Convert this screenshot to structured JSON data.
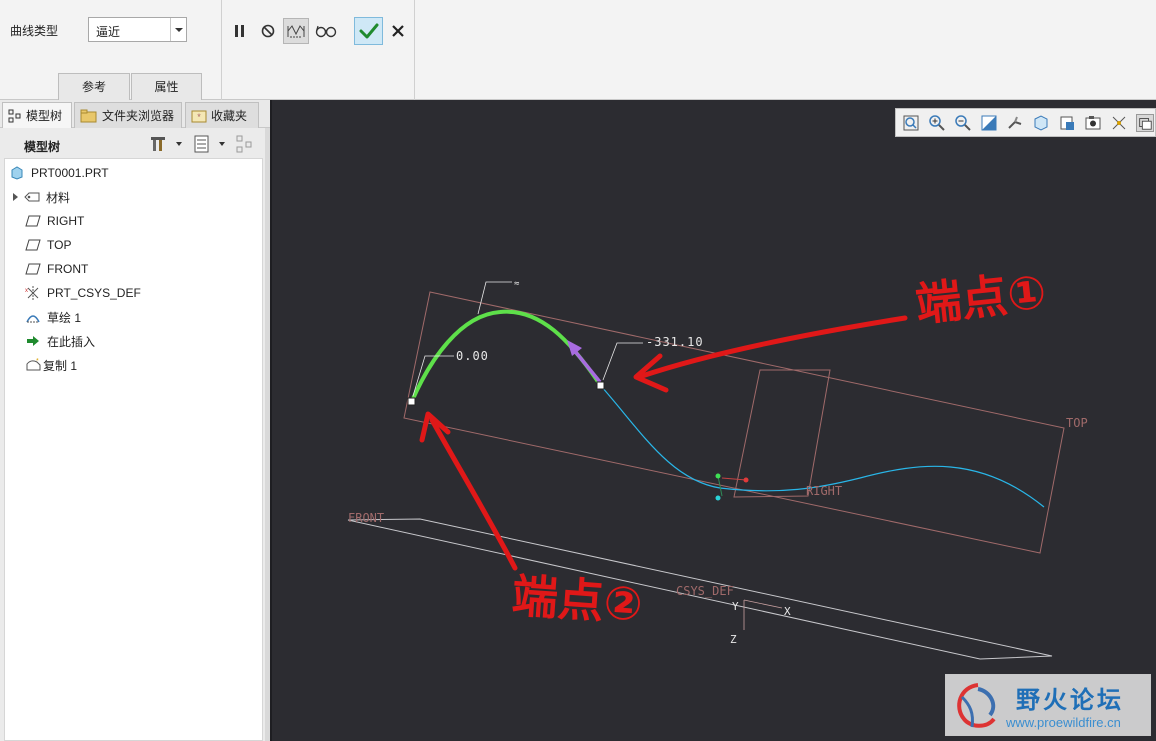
{
  "dashboard": {
    "curve_type_label": "曲线类型",
    "curve_type_value": "逼近",
    "tab_reference": "参考",
    "tab_properties": "属性",
    "tools": [
      "pause-icon",
      "stop-icon",
      "preview-icon",
      "glasses-icon",
      "check-icon",
      "close-icon"
    ]
  },
  "left_panel": {
    "tabs": [
      "模型树",
      "文件夹浏览器",
      "收藏夹"
    ],
    "header_title": "模型树",
    "tree": [
      {
        "label": "PRT0001.PRT",
        "icon": "part-icon"
      },
      {
        "label": "材料",
        "icon": "material-icon"
      },
      {
        "label": "RIGHT",
        "icon": "datum-plane-icon"
      },
      {
        "label": "TOP",
        "icon": "datum-plane-icon"
      },
      {
        "label": "FRONT",
        "icon": "datum-plane-icon"
      },
      {
        "label": "PRT_CSYS_DEF",
        "icon": "csys-icon"
      },
      {
        "label": "草绘 1",
        "icon": "sketch-icon"
      },
      {
        "label": "在此插入",
        "icon": "insert-arrow-icon"
      },
      {
        "label": "复制 1",
        "icon": "copy-icon"
      }
    ]
  },
  "graphics": {
    "dim_start": "0.00",
    "dim_end": "-331.10",
    "plane_top": "TOP",
    "plane_right": "RIGHT",
    "plane_front": "FRONT",
    "csys_label": "CSYS_DEF",
    "axis_x": "X",
    "axis_y": "Y",
    "axis_z": "Z",
    "curve_color": "#5ee04a",
    "spline_color": "#29b6e8",
    "arrow_color": "#a86be0"
  },
  "annotations": {
    "endpoint1": "端点①",
    "endpoint2": "端点②",
    "color": "#e01818"
  },
  "watermark": {
    "title": "野火论坛",
    "url": "www.proewildfire.cn"
  }
}
